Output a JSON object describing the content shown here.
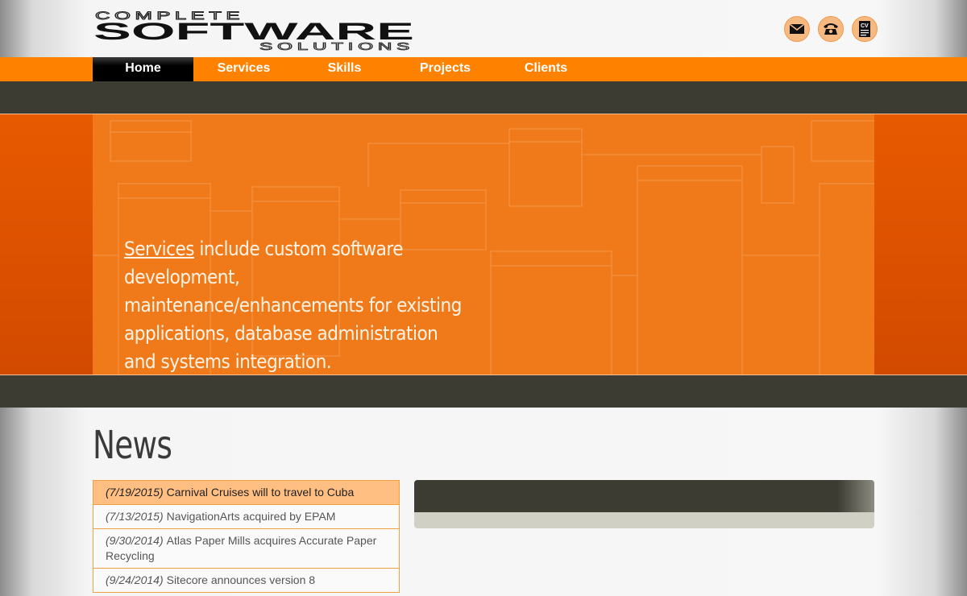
{
  "header": {
    "logo": {
      "line1": "COMPLETE",
      "line2": "SOFTWARE",
      "line3": "SOLUTIONS"
    },
    "contact_icons": [
      "mail-icon",
      "telephone-icon",
      "cv-document-icon"
    ],
    "cv_label": "CV"
  },
  "nav": {
    "items": [
      "Home",
      "Services",
      "Skills",
      "Projects",
      "Clients"
    ],
    "active": "Home"
  },
  "hero": {
    "link": "Services",
    "text": " include custom software development, maintenance/enhancements for existing applications, database administration and systems integration."
  },
  "news": {
    "title": "News",
    "items": [
      {
        "date": "(7/19/2015)",
        "headline": "Carnival Cruises will to travel to Cuba"
      },
      {
        "date": "(7/13/2015)",
        "headline": "NavigationArts acquired by EPAM"
      },
      {
        "date": "(9/30/2014)",
        "headline": "Atlas Paper Mills acquires Accurate Paper Recycling"
      },
      {
        "date": "(9/24/2014)",
        "headline": "Sitecore announces version 8"
      }
    ]
  },
  "colors": {
    "accent": "#ff8100",
    "dark_band": "#3c3c33",
    "hero_bg": "#f07a1a",
    "active_news": "#ffbe82"
  }
}
